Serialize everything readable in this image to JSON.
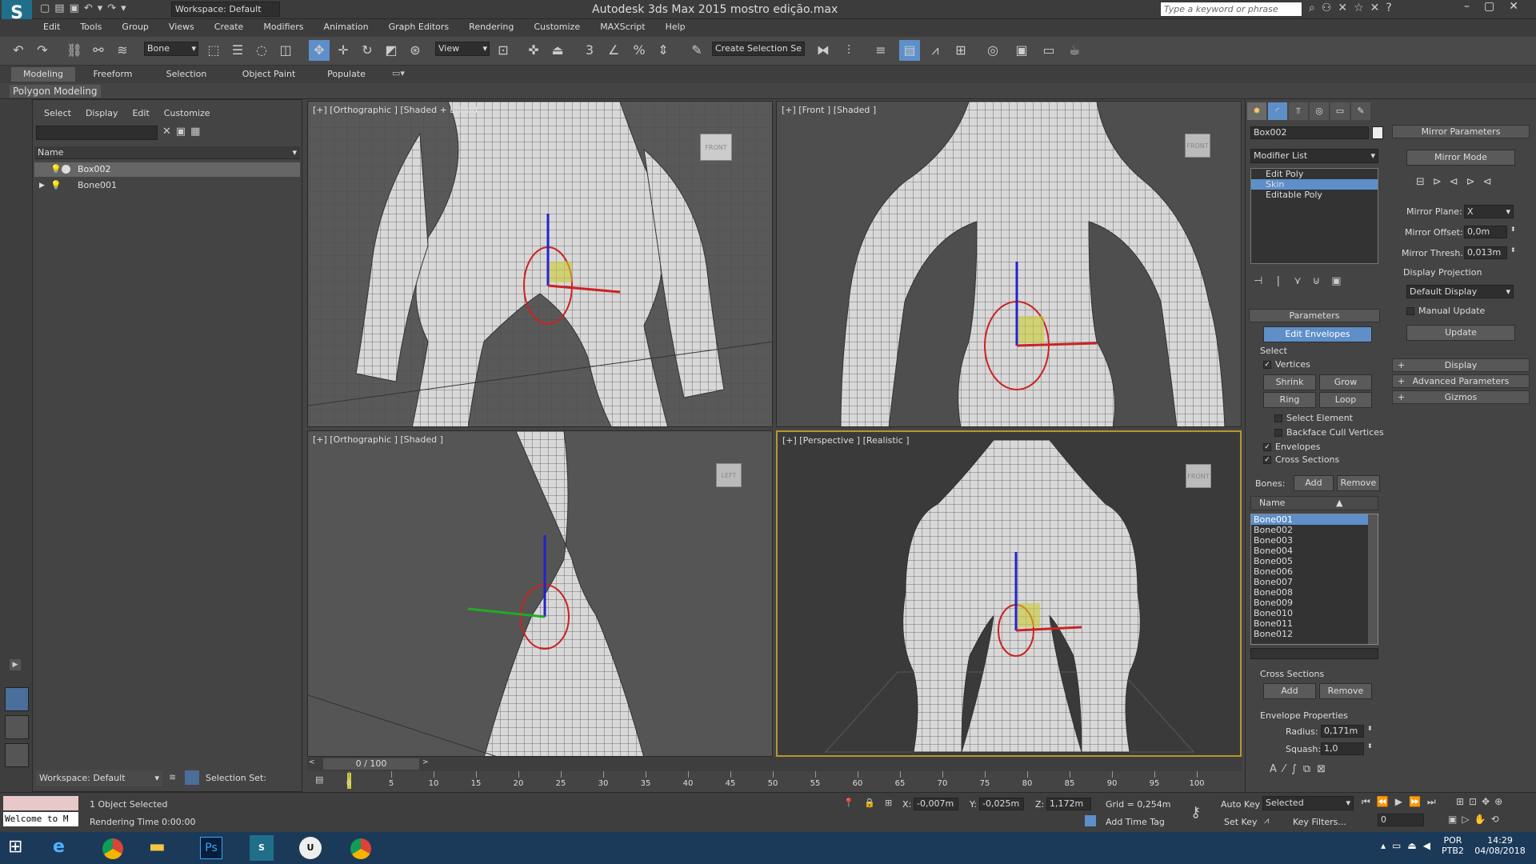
{
  "title_bar": {
    "workspace": "Workspace: Default",
    "app_title": "Autodesk 3ds Max  2015     mostro edição.max",
    "search_placeholder": "Type a keyword or phrase"
  },
  "menu": [
    "Edit",
    "Tools",
    "Group",
    "Views",
    "Create",
    "Modifiers",
    "Animation",
    "Graph Editors",
    "Rendering",
    "Customize",
    "MAXScript",
    "Help"
  ],
  "toolbar": {
    "filter": "Bone",
    "ref_coord": "View",
    "selection_set": "Create Selection Se"
  },
  "ribbon_tabs": [
    "Modeling",
    "Freeform",
    "Selection",
    "Object Paint",
    "Populate"
  ],
  "ribbon_panel": "Polygon Modeling",
  "scene_explorer": {
    "menu": [
      "Select",
      "Display",
      "Edit",
      "Customize"
    ],
    "column": "Name",
    "items": [
      "Box002",
      "Bone001"
    ],
    "workspace": "Workspace: Default",
    "selection_set": "Selection Set:"
  },
  "viewports": [
    {
      "label": "[+] [Orthographic ] [Shaded + Edged",
      "cube": "FRONT"
    },
    {
      "label": "[+] [Front ] [Shaded ]",
      "cube": "FRONT"
    },
    {
      "label": "[+] [Orthographic ] [Shaded ]",
      "cube": "LEFT"
    },
    {
      "label": "[+] [Perspective ] [Realistic ]",
      "cube": "FRONT"
    }
  ],
  "command_panel": {
    "object_name": "Box002",
    "modifier_list": "Modifier List",
    "stack": [
      "Edit Poly",
      "Skin",
      "Editable Poly"
    ],
    "parameters": "Parameters",
    "edit_envelopes": "Edit Envelopes",
    "select": "Select",
    "vertices": "Vertices",
    "shrink": "Shrink",
    "grow": "Grow",
    "ring": "Ring",
    "loop": "Loop",
    "select_element": "Select Element",
    "backface": "Backface Cull Vertices",
    "envelopes": "Envelopes",
    "cross_sections": "Cross Sections",
    "bones_label": "Bones:",
    "add": "Add",
    "remove": "Remove",
    "name_col": "Name",
    "bones": [
      "Bone001",
      "Bone002",
      "Bone003",
      "Bone004",
      "Bone005",
      "Bone006",
      "Bone007",
      "Bone008",
      "Bone009",
      "Bone010",
      "Bone011",
      "Bone012"
    ],
    "cross_sections_group": "Cross Sections",
    "envelope_props": "Envelope Properties",
    "radius_label": "Radius:",
    "radius": "0,171m",
    "squash_label": "Squash:",
    "squash": "1,0"
  },
  "mirror_panel": {
    "title": "Mirror Parameters",
    "mirror_mode": "Mirror Mode",
    "plane_label": "Mirror Plane:",
    "plane": "X",
    "offset_label": "Mirror Offset:",
    "offset": "0,0m",
    "thresh_label": "Mirror Thresh.:",
    "thresh": "0,013m",
    "display_projection": "Display Projection",
    "projection_value": "Default Display",
    "manual_update": "Manual Update",
    "update": "Update",
    "rollouts": [
      "Display",
      "Advanced Parameters",
      "Gizmos"
    ]
  },
  "timeline": {
    "frame": "0 / 100",
    "ticks": [
      "0",
      "5",
      "10",
      "15",
      "20",
      "25",
      "30",
      "35",
      "40",
      "45",
      "50",
      "55",
      "60",
      "65",
      "70",
      "75",
      "80",
      "85",
      "90",
      "95",
      "100"
    ]
  },
  "status": {
    "maxscript": "Welcome to M",
    "selected": "1 Object Selected",
    "render_time": "Rendering Time  0:00:00",
    "x_label": "X:",
    "x": "-0,007m",
    "y_label": "Y:",
    "y": "-0,025m",
    "z_label": "Z:",
    "z": "1,172m",
    "grid": "Grid = 0,254m",
    "add_time_tag": "Add Time Tag",
    "auto_key": "Auto Key",
    "key_mode": "Selected",
    "set_key": "Set Key",
    "key_filters": "Key Filters...",
    "frame_field": "0"
  },
  "taskbar": {
    "lang": "POR",
    "kbd": "PTB2",
    "time": "14:29",
    "date": "04/08/2018"
  }
}
